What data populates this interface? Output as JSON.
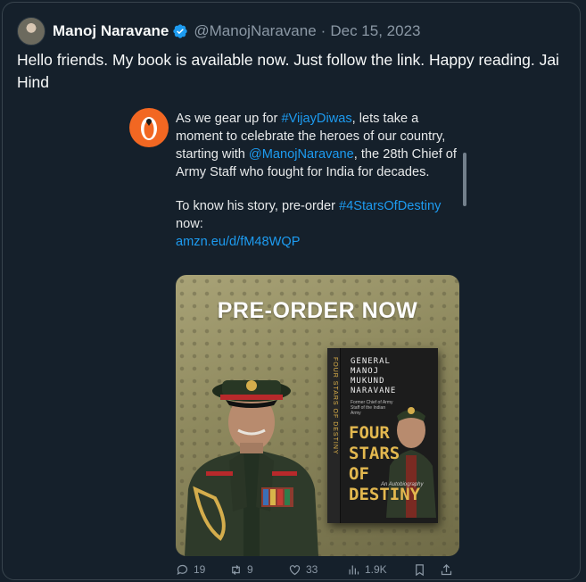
{
  "tweet": {
    "author_name": "Manoj Naravane",
    "handle": "@ManojNaravane",
    "separator": "·",
    "date": "Dec 15, 2023",
    "text": "Hello friends. My book is available now. Just follow the link. Happy reading. Jai Hind",
    "verified": true,
    "accent_color": "#1d9bf0"
  },
  "quoted": {
    "publisher_logo": "penguin-logo",
    "line1_pre": "As we gear up for ",
    "hashtag1": "#VijayDiwas",
    "line1_post": ", lets take a moment to celebrate the heroes of our country, starting with ",
    "mention": "@ManojNaravane",
    "line2": ", the 28th Chief of Army Staff who fought for India for decades.",
    "para2_pre": "To know his story, pre-order ",
    "hashtag2": "#4StarsOfDestiny",
    "para2_post": " now:",
    "url": "amzn.eu/d/fM48WQP"
  },
  "promo_image": {
    "headline": "PRE-ORDER NOW",
    "book_author_lines": [
      "GENERAL",
      "MANOJ",
      "MUKUND",
      "NARAVANE"
    ],
    "book_subtitle": "Former Chief of Army Staff of the Indian Army",
    "book_title_lines": [
      "FOUR",
      "STARS",
      "OF",
      "DESTINY"
    ],
    "book_tagline": "An Autobiography",
    "spine_text": "FOUR STARS OF DESTINY"
  },
  "actions": {
    "replies": "19",
    "reposts": "9",
    "likes": "33",
    "views": "1.9K"
  }
}
